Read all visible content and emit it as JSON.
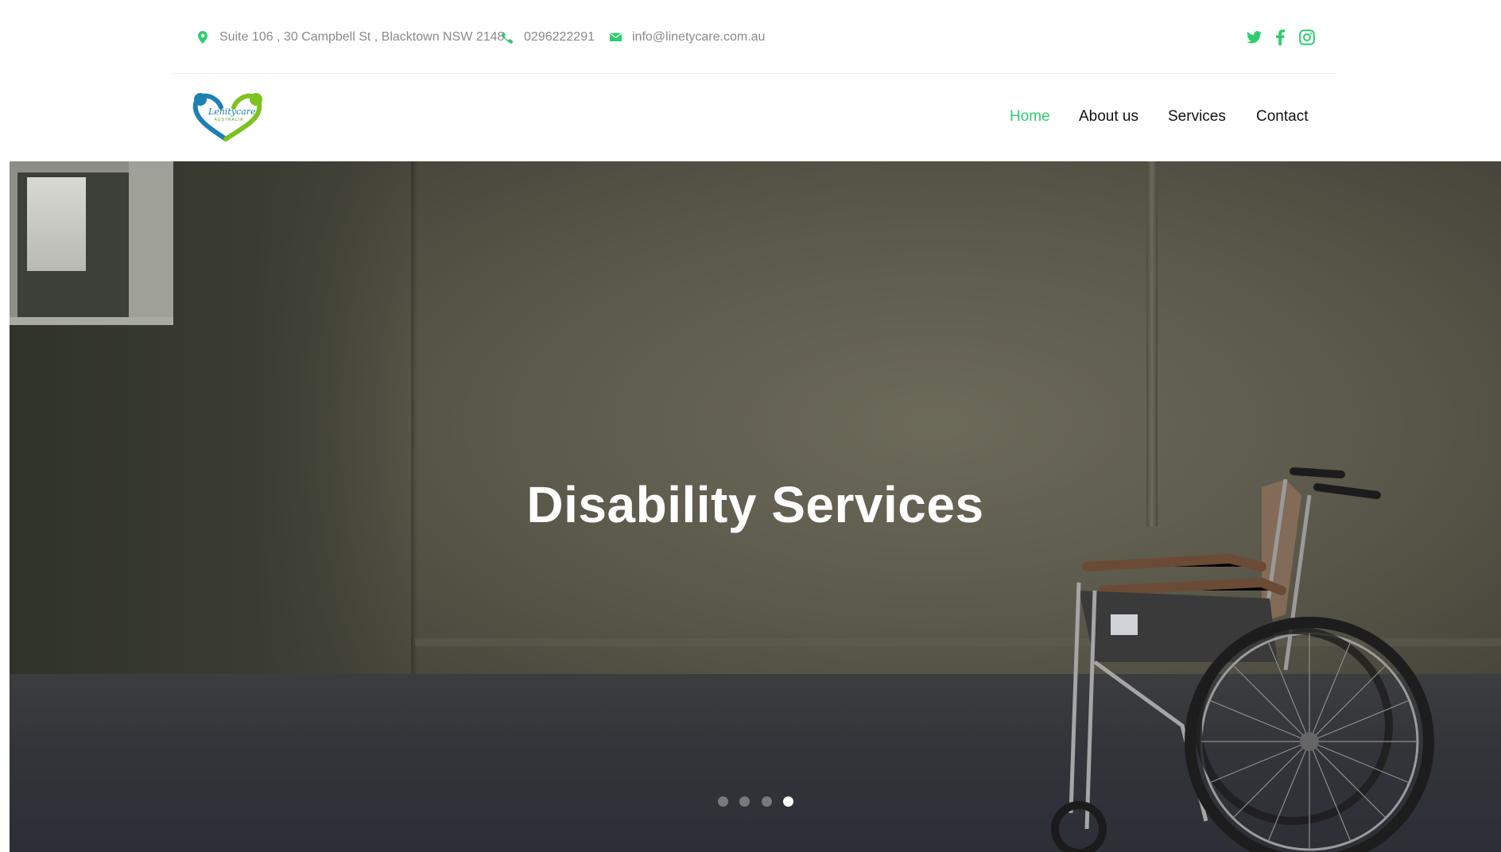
{
  "colors": {
    "accent": "#2ecc71",
    "nav_text": "#111111",
    "contact_text": "#8a8a8a",
    "logo_blue": "#1e7fb4",
    "logo_green": "#7cc31e"
  },
  "topbar": {
    "address": "Suite 106 , 30 Campbell St , Blacktown NSW 2148",
    "phone": "0296222291",
    "email": "info@linetycare.com.au",
    "icons": {
      "address": "map-pin-icon",
      "phone": "phone-icon",
      "email": "envelope-icon"
    },
    "social": [
      "twitter-icon",
      "facebook-icon",
      "instagram-icon"
    ]
  },
  "logo": {
    "name": "Lenitycare",
    "sub": "AUSTRALIA"
  },
  "nav": {
    "items": [
      {
        "label": "Home",
        "active": true
      },
      {
        "label": "About us",
        "active": false
      },
      {
        "label": "Services",
        "active": false
      },
      {
        "label": "Contact",
        "active": false
      }
    ]
  },
  "hero": {
    "title": "Disability Services",
    "slide_count": 4,
    "active_slide": 4
  }
}
